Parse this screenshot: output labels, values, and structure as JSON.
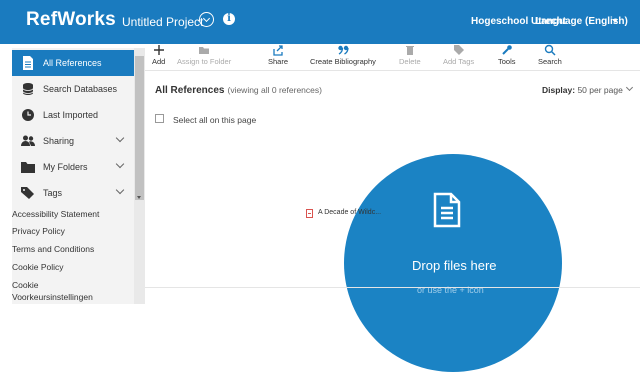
{
  "header": {
    "logo": "RefWorks",
    "project": "Untitled Project",
    "institution": "Hogeschool Utrecht",
    "language": "Language (English)",
    "icons": {
      "project_dropdown": "chevron-down-circle-icon",
      "project_info": "info-circle-icon",
      "language_caret": "caret-down-icon"
    }
  },
  "colors": {
    "brand": "#1a7bbf",
    "drop_zone": "#1b83c4"
  },
  "toolbar": {
    "add": "Add",
    "assign": "Assign to Folder",
    "share": "Share",
    "bibliography": "Create Bibliography",
    "delete": "Delete",
    "tags": "Add Tags",
    "tools": "Tools",
    "search": "Search"
  },
  "sidebar": {
    "items": [
      {
        "label": "All References",
        "icon": "document-icon"
      },
      {
        "label": "Search Databases",
        "icon": "database-icon"
      },
      {
        "label": "Last Imported",
        "icon": "clock-icon"
      },
      {
        "label": "Sharing",
        "icon": "users-icon"
      },
      {
        "label": "My Folders",
        "icon": "folder-icon"
      },
      {
        "label": "Tags",
        "icon": "tag-icon"
      }
    ],
    "links": [
      "Accessibility Statement",
      "Privacy Policy",
      "Terms and Conditions",
      "Cookie Policy",
      "Cookie",
      "Voorkeursinstellingen"
    ]
  },
  "main": {
    "title": "All References",
    "subtitle": "(viewing all 0 references)",
    "display_label": "Display:",
    "display_value": "50 per page",
    "select_all": "Select all on this page",
    "dragging_file": "A Decade of Wildc..."
  },
  "dropzone": {
    "text": "Drop files here",
    "subtext": "or use the + icon"
  }
}
